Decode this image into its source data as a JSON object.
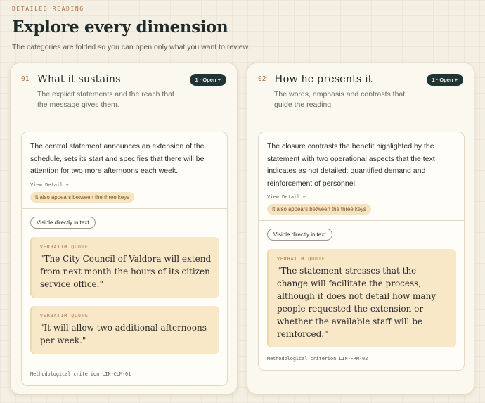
{
  "header": {
    "eyebrow": "DETAILED READING",
    "title": "Explore every dimension",
    "subtitle": "The categories are folded so you can open only what you want to review."
  },
  "cards": [
    {
      "number": "01",
      "title": "What it sustains",
      "description": "The explicit statements and the reach that the message gives them.",
      "open_label": "1 · Open +",
      "summary": "The central statement announces an extension of the schedule, sets its start and specifies that there will be attention for two more afternoons each week.",
      "view_detail": "View Detail +",
      "keys_badge": "It also appears between the three keys",
      "visible_label": "Visible directly in text",
      "quotes": [
        {
          "label": "VERBATIM QUOTE",
          "text": "\"The City Council of Valdora will extend from next month the hours of its citizen service office.\""
        },
        {
          "label": "VERBATIM QUOTE",
          "text": "\"It will allow two additional afternoons per week.\""
        }
      ],
      "method": "Methodological criterion LIN-CLM-01"
    },
    {
      "number": "02",
      "title": "How he presents it",
      "description": "The words, emphasis and contrasts that guide the reading.",
      "open_label": "1 · Open +",
      "summary": "The closure contrasts the benefit highlighted by the statement with two operational aspects that the text indicates as not detailed: quantified demand and reinforcement of personnel.",
      "view_detail": "View Detail +",
      "keys_badge": "It also appears between the three keys",
      "visible_label": "Visible directly in text",
      "quotes": [
        {
          "label": "VERBATIM QUOTE",
          "text": "\"The statement stresses that the change will facilitate the process, although it does not detail how many people requested the extension or whether the available staff will be reinforced.\""
        }
      ],
      "method": "Methodological criterion LIN-FRM-02"
    }
  ]
}
